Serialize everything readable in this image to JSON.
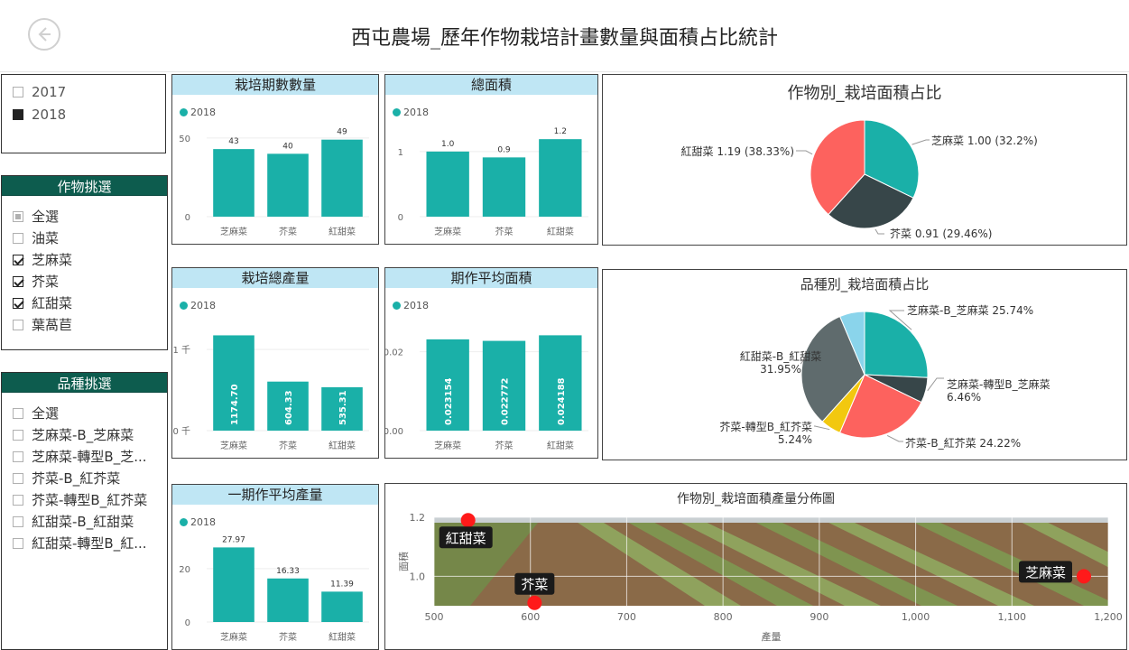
{
  "page": {
    "title": "西屯農場_歷年作物栽培計畫數量與面積占比統計"
  },
  "year_slicer": {
    "items": [
      {
        "label": "2017",
        "checked": false
      },
      {
        "label": "2018",
        "checked": true
      }
    ]
  },
  "crop_slicer": {
    "title": "作物挑選",
    "items": [
      {
        "label": "全選",
        "state": "partial"
      },
      {
        "label": "油菜",
        "state": "unchecked"
      },
      {
        "label": "芝麻菜",
        "state": "checked"
      },
      {
        "label": "芥菜",
        "state": "checked"
      },
      {
        "label": "紅甜菜",
        "state": "checked"
      },
      {
        "label": "葉萵苣",
        "state": "unchecked"
      }
    ]
  },
  "variety_slicer": {
    "title": "品種挑選",
    "items": [
      {
        "label": "全選"
      },
      {
        "label": "芝麻菜-B_芝麻菜"
      },
      {
        "label": "芝麻菜-轉型B_芝..."
      },
      {
        "label": "芥菜-B_紅芥菜"
      },
      {
        "label": "芥菜-轉型B_紅芥菜"
      },
      {
        "label": "紅甜菜-B_紅甜菜"
      },
      {
        "label": "紅甜菜-轉型B_紅..."
      }
    ]
  },
  "colors": {
    "teal": "#1ab0a8",
    "dark": "#374649",
    "red": "#fd625e",
    "yellow": "#f2c80f",
    "slate": "#5f6b6d",
    "light_blue": "#8ad4eb",
    "slicer_header": "#0d5c4e",
    "card_header": "#bfe6f4"
  },
  "chart_data": [
    {
      "id": "cultivation-count",
      "type": "bar",
      "title": "栽培期數數量",
      "legend": "2018",
      "categories": [
        "芝麻菜",
        "芥菜",
        "紅甜菜"
      ],
      "values": [
        43,
        40,
        49
      ],
      "labels": [
        "43",
        "40",
        "49"
      ],
      "yticks": [
        {
          "v": 0,
          "t": "0"
        },
        {
          "v": 50,
          "t": "50"
        }
      ],
      "ylim": [
        0,
        58
      ]
    },
    {
      "id": "total-area",
      "type": "bar",
      "title": "總面積",
      "legend": "2018",
      "categories": [
        "芝麻菜",
        "芥菜",
        "紅甜菜"
      ],
      "values": [
        1.0,
        0.91,
        1.19
      ],
      "labels": [
        "1.0",
        "0.9",
        "1.2"
      ],
      "yticks": [
        {
          "v": 0,
          "t": "0"
        },
        {
          "v": 1,
          "t": "1"
        }
      ],
      "ylim": [
        0,
        1.4
      ]
    },
    {
      "id": "total-yield",
      "type": "bar",
      "title": "栽培總產量",
      "legend": "2018",
      "categories": [
        "芝麻菜",
        "芥菜",
        "紅甜菜"
      ],
      "values": [
        1174.7,
        604.33,
        535.31
      ],
      "labels": [
        "1174.70",
        "604.33",
        "535.31"
      ],
      "label_inside": true,
      "yticks": [
        {
          "v": 0,
          "t": "0 千"
        },
        {
          "v": 1000,
          "t": "1 千"
        }
      ],
      "ylim": [
        0,
        1380
      ]
    },
    {
      "id": "avg-area",
      "type": "bar",
      "title": "期作平均面積",
      "legend": "2018",
      "categories": [
        "芝麻菜",
        "芥菜",
        "紅甜菜"
      ],
      "values": [
        0.023154,
        0.022772,
        0.024188
      ],
      "labels": [
        "0.023154",
        "0.022772",
        "0.024188"
      ],
      "label_inside": true,
      "yticks": [
        {
          "v": 0,
          "t": "0.00"
        },
        {
          "v": 0.02,
          "t": "0.02"
        }
      ],
      "ylim": [
        0,
        0.0284
      ]
    },
    {
      "id": "avg-yield",
      "type": "bar",
      "title": "一期作平均產量",
      "legend": "2018",
      "categories": [
        "芝麻菜",
        "芥菜",
        "紅甜菜"
      ],
      "values": [
        27.97,
        16.33,
        11.39
      ],
      "labels": [
        "27.97",
        "16.33",
        "11.39"
      ],
      "yticks": [
        {
          "v": 0,
          "t": "0"
        },
        {
          "v": 20,
          "t": "20"
        }
      ],
      "ylim": [
        0,
        32.5
      ]
    },
    {
      "id": "crop-area-pie",
      "type": "pie",
      "title": "作物別_栽培面積占比",
      "slices": [
        {
          "name": "芝麻菜",
          "label": "芝麻菜 1.00 (32.2%)",
          "percent": 32.2,
          "color": "#1ab0a8"
        },
        {
          "name": "芥菜",
          "label": "芥菜 0.91 (29.46%)",
          "percent": 29.46,
          "color": "#374649"
        },
        {
          "name": "紅甜菜",
          "label": "紅甜菜 1.19 (38.33%)",
          "percent": 38.33,
          "color": "#fd625e"
        }
      ]
    },
    {
      "id": "variety-area-pie",
      "type": "pie",
      "title": "品種別_栽培面積占比",
      "slices": [
        {
          "name": "芝麻菜-B_芝麻菜",
          "label": "芝麻菜-B_芝麻菜 25.74%",
          "percent": 25.74,
          "color": "#1ab0a8"
        },
        {
          "name": "芝麻菜-轉型B_芝麻菜",
          "label": "芝麻菜-轉型B_芝麻菜 6.46%",
          "percent": 6.46,
          "color": "#374649"
        },
        {
          "name": "芥菜-B_紅芥菜",
          "label": "芥菜-B_紅芥菜 24.22%",
          "percent": 24.22,
          "color": "#fd625e"
        },
        {
          "name": "芥菜-轉型B_紅芥菜",
          "label": "芥菜-轉型B_紅芥菜 5.24%",
          "percent": 5.24,
          "color": "#f2c80f"
        },
        {
          "name": "紅甜菜-B_紅甜菜",
          "label": "紅甜菜-B_紅甜菜 31.95%",
          "percent": 31.95,
          "color": "#5f6b6d"
        },
        {
          "name": "紅甜菜-轉型B_紅甜菜",
          "label": "",
          "percent": 6.39,
          "color": "#8ad4eb"
        }
      ]
    },
    {
      "id": "area-yield-scatter",
      "type": "scatter",
      "title": "作物別_栽培面積產量分佈圖",
      "xlabel": "產量",
      "ylabel": "面積",
      "xlim": [
        500,
        1200
      ],
      "ylim": [
        0.9,
        1.2
      ],
      "xticks": [
        500,
        600,
        700,
        800,
        900,
        1000,
        1100,
        1200
      ],
      "xtick_labels": [
        "500",
        "600",
        "700",
        "800",
        "900",
        "1,000",
        "1,100",
        "1,200"
      ],
      "yticks": [
        1.0,
        1.2
      ],
      "ytick_labels": [
        "1.0",
        "1.2"
      ],
      "points": [
        {
          "name": "紅甜菜",
          "x": 535.31,
          "y": 1.19
        },
        {
          "name": "芥菜",
          "x": 604.33,
          "y": 0.91
        },
        {
          "name": "芝麻菜",
          "x": 1174.7,
          "y": 1.0
        }
      ]
    }
  ]
}
